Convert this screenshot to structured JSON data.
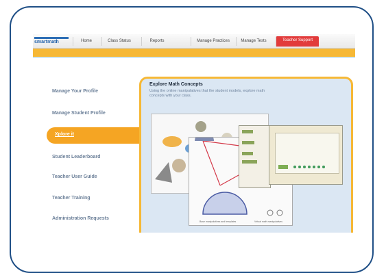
{
  "app": {
    "logo_text": "smartmath",
    "nav_tabs": [
      {
        "label": "Home"
      },
      {
        "label": "Class Status"
      },
      {
        "label": "Reports"
      },
      {
        "label": "Manage Practices"
      },
      {
        "label": "Manage Tests"
      },
      {
        "label": "Teacher Support"
      }
    ]
  },
  "sidebar": {
    "items": [
      {
        "label": "Manage Your Profile"
      },
      {
        "label": "Manage Student Profile"
      },
      {
        "label": "Xplore it"
      },
      {
        "label": "Student Leaderboard"
      },
      {
        "label": "Teacher User Guide"
      },
      {
        "label": "Teacher Training"
      },
      {
        "label": "Administration Requests"
      }
    ]
  },
  "panel": {
    "title": "Explore Math Concepts",
    "description": "Using the online manipulatives that the student models, explore math concepts with your class.",
    "caption_left": "Base manipulatives and templates",
    "caption_right": "Virtual math manipulatives"
  },
  "colors": {
    "frame_border": "#1f4f86",
    "orange_accent": "#f5a523",
    "active_tab": "#e23b3b",
    "panel_bg": "#dbe7f3"
  }
}
